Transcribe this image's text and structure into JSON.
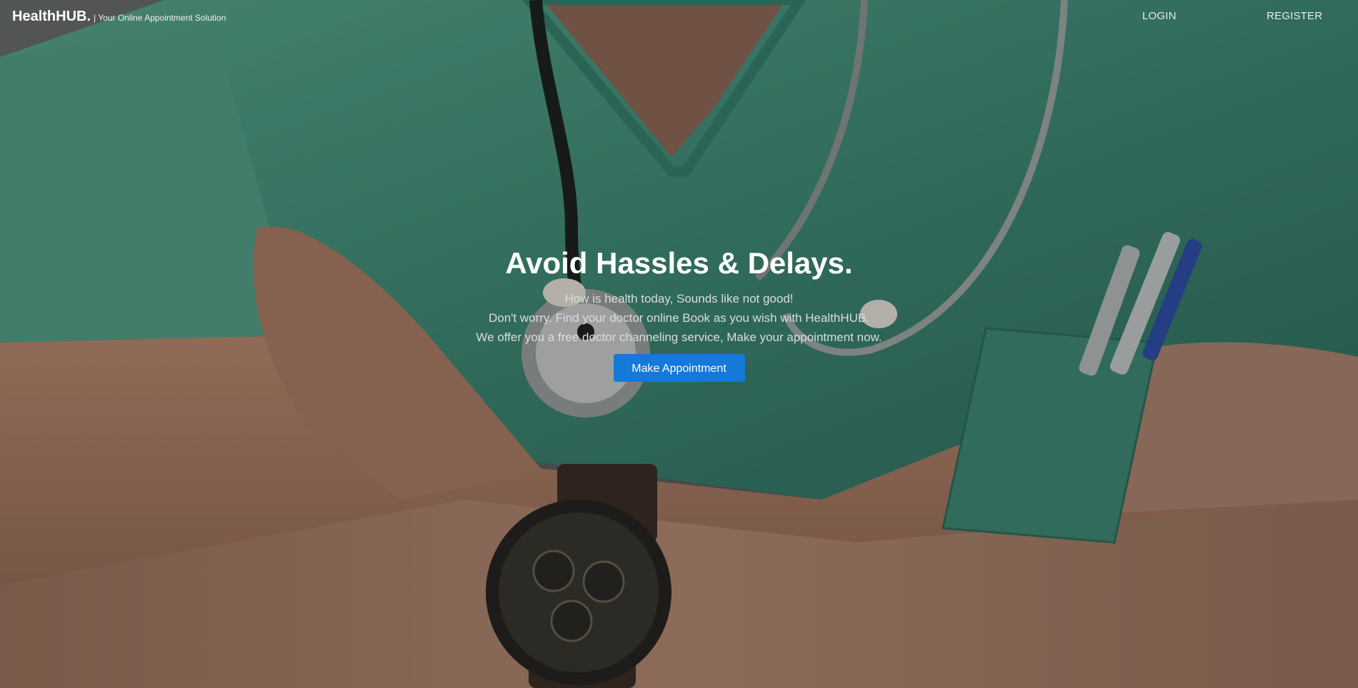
{
  "header": {
    "brand_name": "HealthHUB.",
    "brand_tagline": "| Your Online Appointment Solution",
    "nav": {
      "login_label": "LOGIN",
      "register_label": "REGISTER"
    }
  },
  "hero": {
    "title": "Avoid Hassles & Delays.",
    "lines": [
      "How is health today, Sounds like not good!",
      "Don't worry. Find your doctor online Book as you wish with HealthHUB.",
      "We offer you a free doctor channeling service, Make your appointment now."
    ],
    "cta_label": "Make Appointment"
  },
  "colors": {
    "cta_background": "#1479d8",
    "scrubs_teal": "#4f9a86",
    "skin": "#a57a63"
  }
}
